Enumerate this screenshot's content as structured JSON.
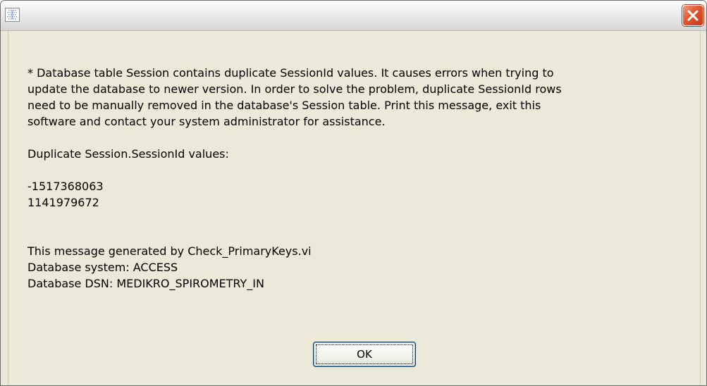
{
  "window": {
    "close_icon": "close-x-icon",
    "app_icon": "grid-app-icon"
  },
  "message": {
    "text": "* Database table Session contains duplicate SessionId values. It causes errors when trying to\nupdate the database to newer version. In order to solve the problem, duplicate SessionId rows\nneed to be manually removed in the database's Session table. Print this message, exit this\nsoftware and contact your system administrator for assistance.\n\nDuplicate Session.SessionId values:\n\n-1517368063\n1141979672\n\n\nThis message generated by Check_PrimaryKeys.vi\nDatabase system: ACCESS\nDatabase DSN: MEDIKRO_SPIROMETRY_IN"
  },
  "buttons": {
    "ok_label": "OK"
  },
  "colors": {
    "dialog_background": "#ece9d8",
    "close_button_red": "#e0572f",
    "button_border": "#003c74"
  }
}
